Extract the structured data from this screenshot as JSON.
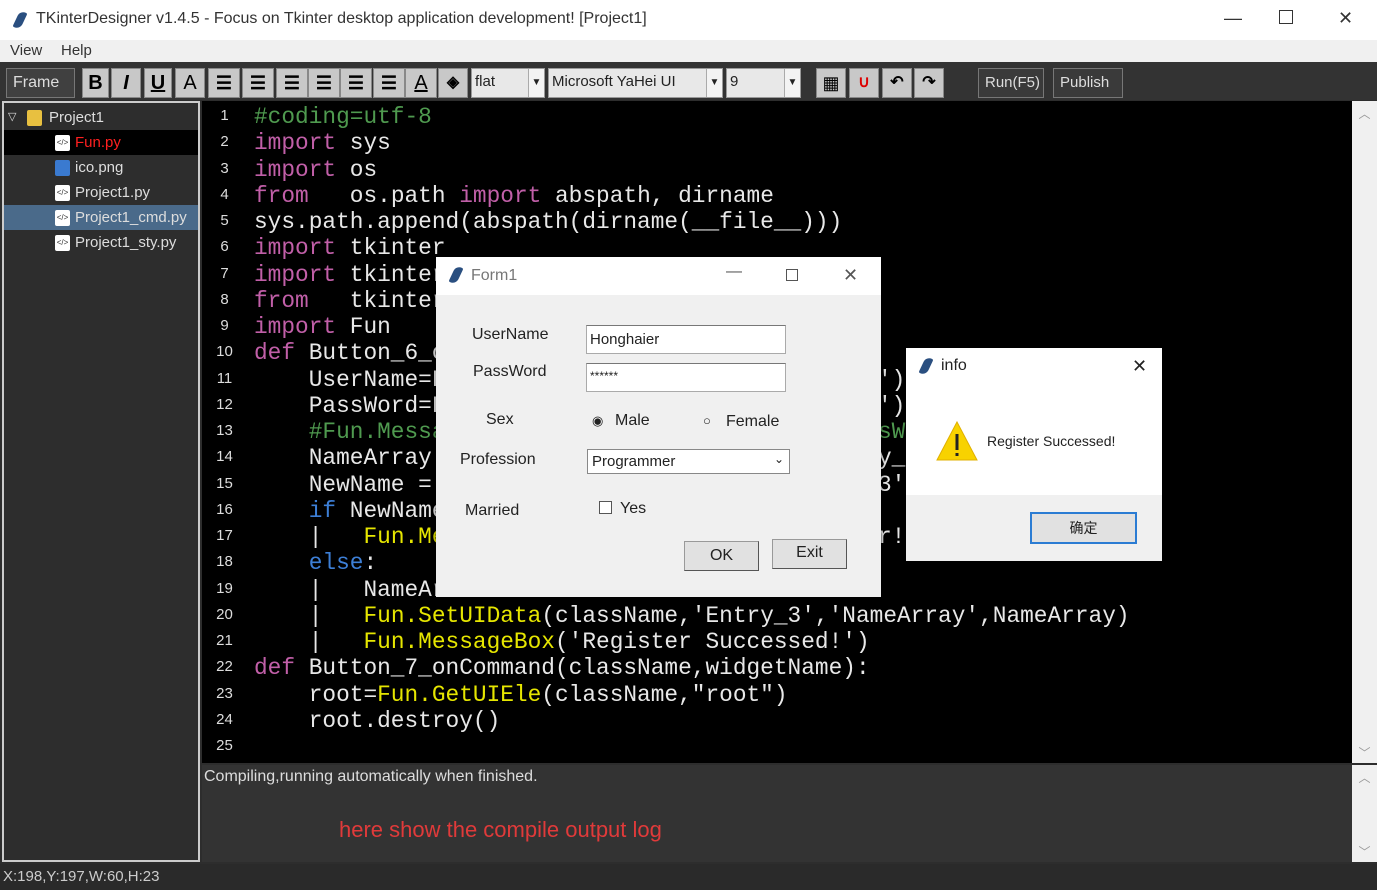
{
  "window": {
    "title": "TKinterDesigner v1.4.5 - Focus on Tkinter desktop application development!   [Project1]"
  },
  "menu": [
    "View",
    "Help"
  ],
  "toolbar": {
    "frame": "Frame",
    "style_buttons": [
      "B",
      "I",
      "U",
      "A"
    ],
    "relief": "flat",
    "font": "Microsoft YaHei UI",
    "size": "9",
    "run": "Run(F5)",
    "publish": "Publish"
  },
  "tree": {
    "root": "Project1",
    "files": [
      {
        "name": "Fun.py",
        "state": "active-red"
      },
      {
        "name": "ico.png"
      },
      {
        "name": "Project1.py"
      },
      {
        "name": "Project1_cmd.py",
        "state": "selected"
      },
      {
        "name": "Project1_sty.py"
      }
    ]
  },
  "colors": {
    "keyword": "#c15fa8",
    "comment": "#4f9a4f",
    "func": "#e6e600",
    "control": "#3d7fd6",
    "text": "#e8e8e8",
    "log_hint": "#e03a3a"
  },
  "code": {
    "line_numbers": [
      "1",
      "2",
      "3",
      "4",
      "5",
      "6",
      "7",
      "8",
      "9",
      "10",
      "11",
      "12",
      "13",
      "14",
      "15",
      "16",
      "17",
      "18",
      "19",
      "20",
      "21",
      "22",
      "23",
      "24",
      "25"
    ],
    "lines": [
      [
        [
          "#coding=utf-8",
          "comment"
        ]
      ],
      [
        [
          "import",
          "keyword"
        ],
        [
          " sys",
          "text"
        ]
      ],
      [
        [
          "import",
          "keyword"
        ],
        [
          " os",
          "text"
        ]
      ],
      [
        [
          "from",
          "keyword"
        ],
        [
          "   os.path ",
          "text"
        ],
        [
          "import",
          "keyword"
        ],
        [
          " abspath, dirname",
          "text"
        ]
      ],
      [
        [
          "sys.path.append(abspath(dirname(__file__)))",
          "text"
        ]
      ],
      [
        [
          "import",
          "keyword"
        ],
        [
          " tkinter",
          "text"
        ]
      ],
      [
        [
          "import",
          "keyword"
        ],
        [
          " tkinter",
          "text"
        ]
      ],
      [
        [
          "from",
          "keyword"
        ],
        [
          "   tkinter",
          "text"
        ]
      ],
      [
        [
          "import",
          "keyword"
        ],
        [
          " Fun",
          "text"
        ]
      ],
      [
        [
          "def",
          "keyword"
        ],
        [
          " Button_6_c",
          "text"
        ]
      ],
      [
        [
          "    UserName=F",
          "text"
        ]
      ],
      [
        [
          "    PassWord=F",
          "text"
        ]
      ],
      [
        [
          "    #Fun.Messa",
          "comment"
        ]
      ],
      [
        [
          "    NameArray",
          "text"
        ]
      ],
      [
        [
          "    NewName =",
          "text"
        ]
      ],
      [
        [
          "    ",
          "text"
        ],
        [
          "if",
          "control"
        ],
        [
          " NewName",
          "text"
        ]
      ],
      [
        [
          "    |   ",
          "text"
        ],
        [
          "Fun.Me",
          "func"
        ]
      ],
      [
        [
          "    ",
          "text"
        ],
        [
          "else",
          "control"
        ],
        [
          ":",
          "text"
        ]
      ],
      [
        [
          "    |   NameAr",
          "text"
        ]
      ],
      [
        [
          "    |   ",
          "text"
        ],
        [
          "Fun.SetUIData",
          "func"
        ],
        [
          "(className,'Entry_3','NameArray',NameArray)",
          "text"
        ]
      ],
      [
        [
          "    |   ",
          "text"
        ],
        [
          "Fun.MessageBox",
          "func"
        ],
        [
          "('Register Successed!')",
          "text"
        ]
      ],
      [
        [
          "def",
          "keyword"
        ],
        [
          " Button_7_onCommand(className,widgetName):",
          "text"
        ]
      ],
      [
        [
          "    root=",
          "text"
        ],
        [
          "Fun.GetUIEle",
          "func"
        ],
        [
          "(className,\"root\")",
          "text"
        ]
      ],
      [
        [
          "    root.destroy()",
          "text"
        ]
      ],
      []
    ],
    "right_fragments": [
      {
        "line": 11,
        "text": "')",
        "kind": "text"
      },
      {
        "line": 12,
        "text": "')",
        "kind": "text"
      },
      {
        "line": 13,
        "text": "sWo",
        "kind": "comment"
      },
      {
        "line": 14,
        "text": "y_3",
        "kind": "text"
      },
      {
        "line": 15,
        "text": "3')",
        "kind": "text"
      },
      {
        "line": 17,
        "text": "r!'",
        "kind": "text"
      }
    ]
  },
  "output": {
    "line1": "Compiling,running automatically when finished.",
    "hint": "here show the compile output log"
  },
  "status": "X:198,Y:197,W:60,H:23",
  "form1": {
    "title": "Form1",
    "username_label": "UserName",
    "username_value": "Honghaier",
    "password_label": "PassWord",
    "password_value": "******",
    "sex_label": "Sex",
    "male": "Male",
    "female": "Female",
    "sex_selected": "Male",
    "profession_label": "Profession",
    "profession_value": "Programmer",
    "married_label": "Married",
    "married_option": "Yes",
    "married_checked": false,
    "ok": "OK",
    "exit": "Exit"
  },
  "info": {
    "title": "info",
    "message": "Register Successed!",
    "ok": "确定",
    "icon": "warning-icon"
  }
}
